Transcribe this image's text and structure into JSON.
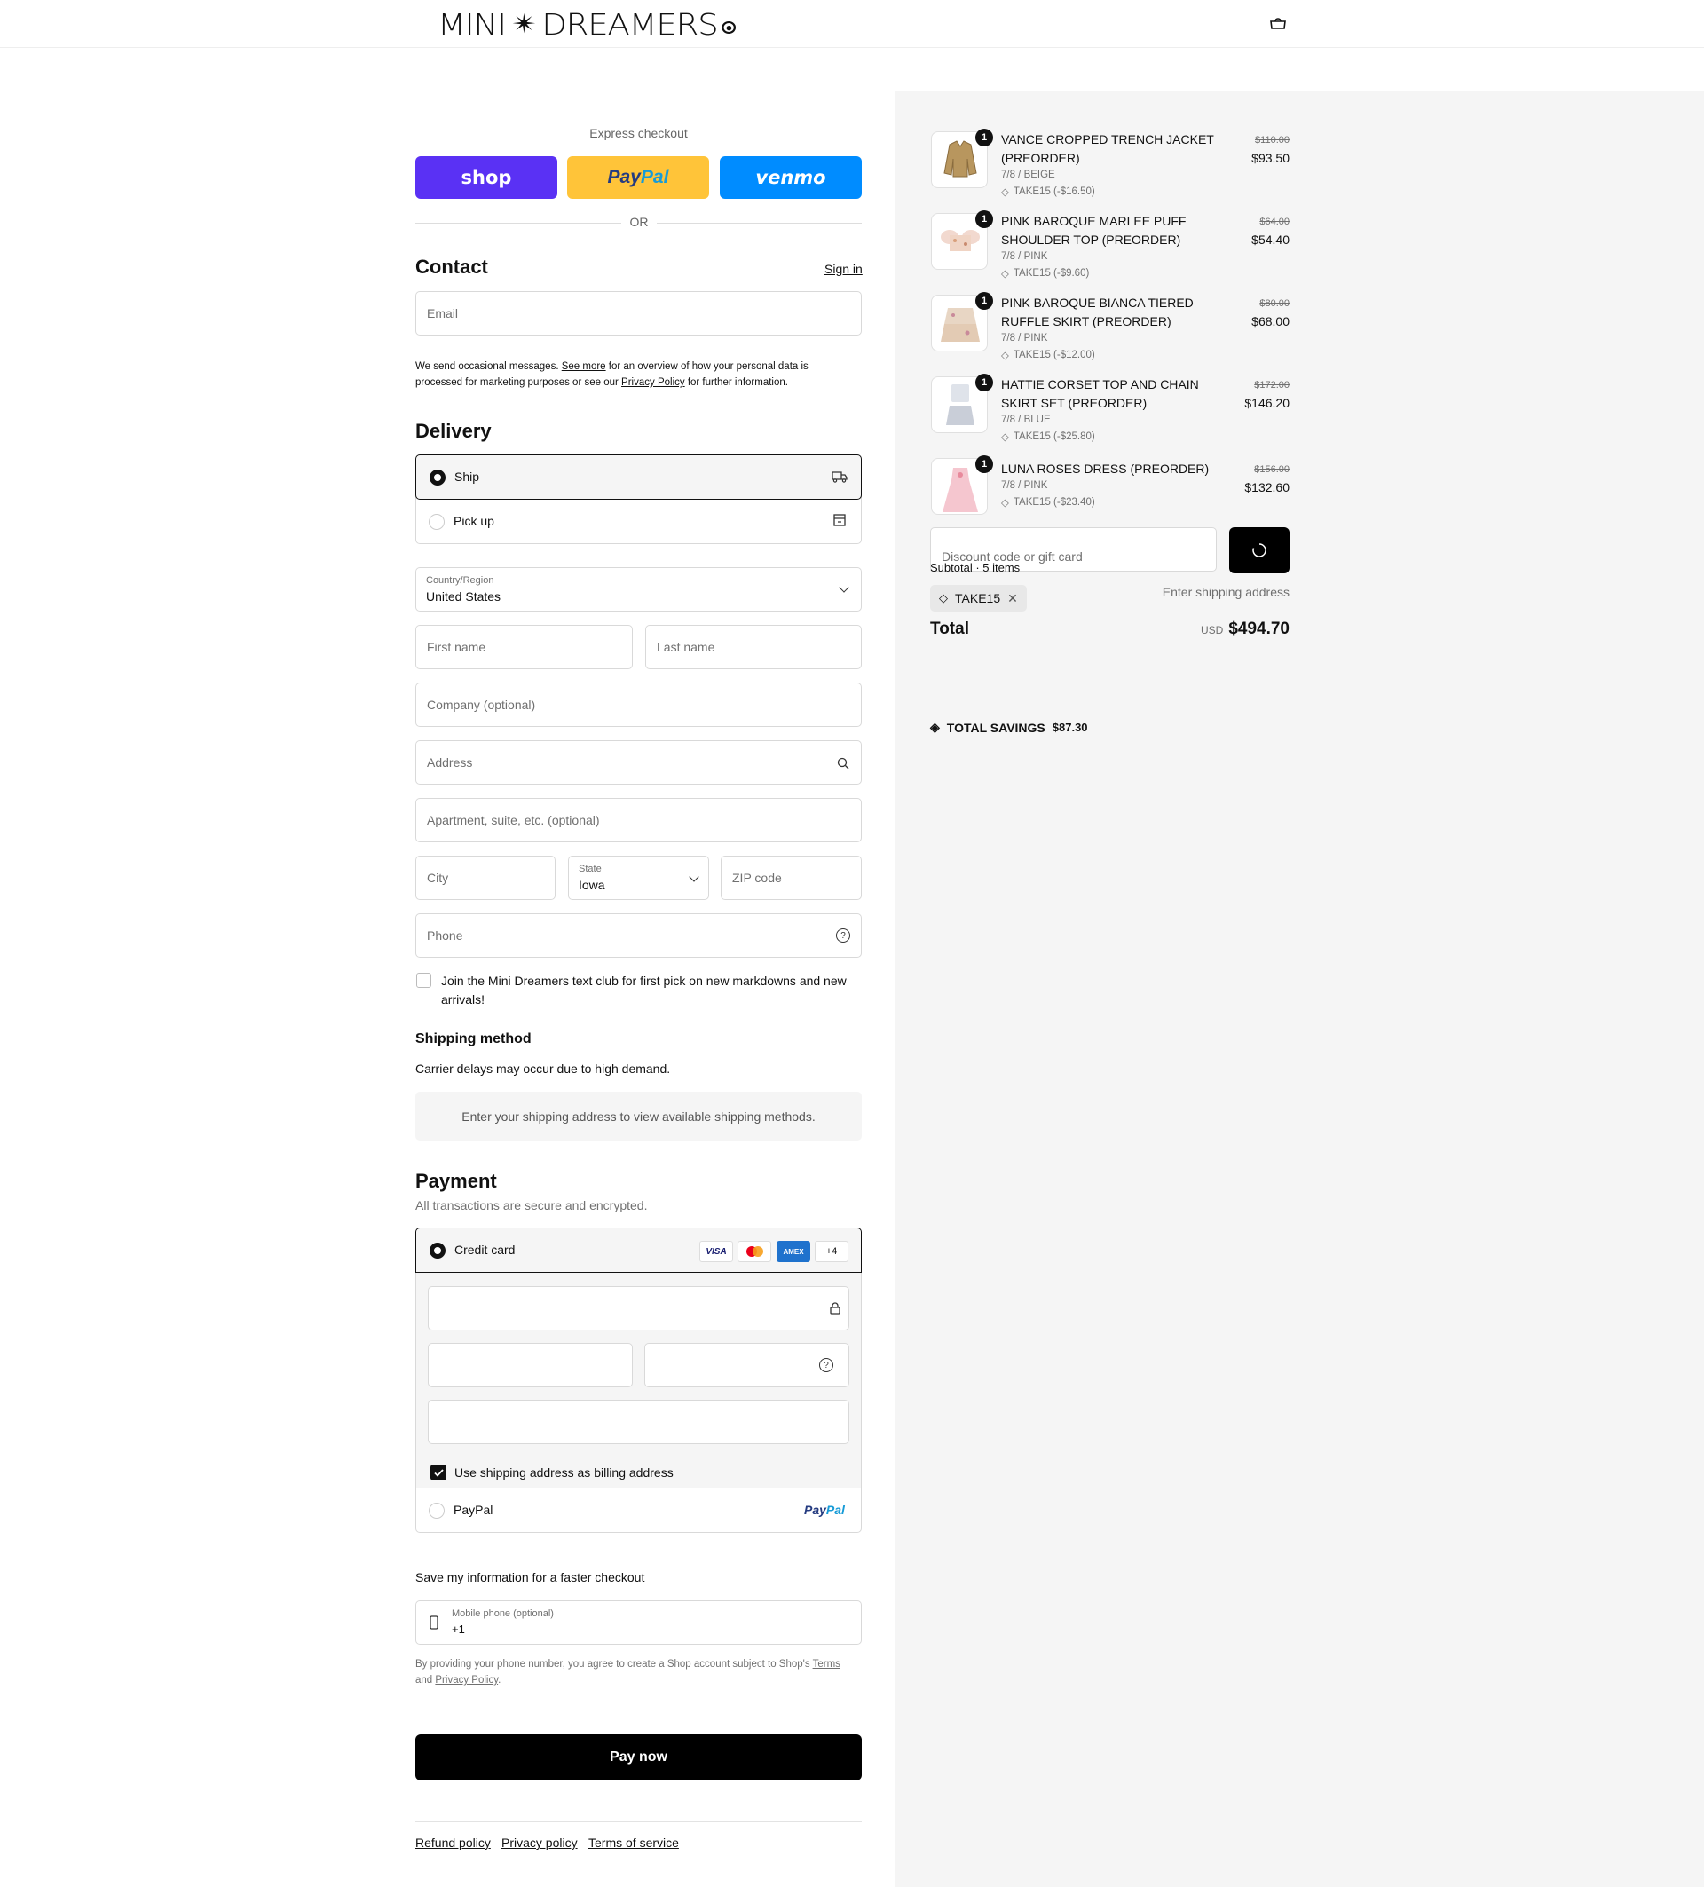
{
  "header": {
    "logo_text": "MINI",
    "logo_text2": "DREAMERS",
    "bag_icon": "bag-icon"
  },
  "express": {
    "label": "Express checkout",
    "shop": "shop",
    "paypal_1": "Pay",
    "paypal_2": "Pal",
    "venmo": "venmo",
    "or": "OR"
  },
  "contact": {
    "title": "Contact",
    "sign_in": "Sign in",
    "email_placeholder": "Email",
    "notice_1": "We send occasional messages. ",
    "notice_see_more": "See more",
    "notice_2": " for an overview of how your personal data is",
    "notice_3": "processed for marketing purposes or see our ",
    "notice_privacy": "Privacy Policy",
    "notice_4": " for further information."
  },
  "delivery": {
    "title": "Delivery",
    "ship": "Ship",
    "pickup": "Pick up",
    "country_label": "Country/Region",
    "country_value": "United States",
    "first_name": "First name",
    "last_name": "Last name",
    "company": "Company (optional)",
    "address": "Address",
    "apartment": "Apartment, suite, etc. (optional)",
    "city": "City",
    "state_label": "State",
    "state_value": "Iowa",
    "zip": "ZIP code",
    "phone": "Phone",
    "textclub_1": "Join the Mini Dreamers text club for first pick on new markdowns and new",
    "textclub_2": "arrivals!"
  },
  "shipping": {
    "title": "Shipping method",
    "note": "Carrier delays may occur due to high demand.",
    "placeholder": "Enter your shipping address to view available shipping methods."
  },
  "payment": {
    "title": "Payment",
    "subtitle": "All transactions are secure and encrypted.",
    "credit_card": "Credit card",
    "visa": "VISA",
    "amex": "AMEX",
    "more": "+4",
    "billing": "Use shipping address as billing address",
    "paypal": "PayPal",
    "paypal_logo_1": "Pay",
    "paypal_logo_2": "Pal"
  },
  "save": {
    "title": "Save my information for a faster checkout",
    "mobile_label": "Mobile phone (optional)",
    "mobile_value": "+1",
    "terms_1": "By providing your phone number, you agree to create a Shop account subject to Shop's ",
    "terms_link": "Terms",
    "terms_2": "and ",
    "privacy_link": "Privacy Policy",
    "terms_3": "."
  },
  "pay_now": "Pay now",
  "footer": {
    "refund": "Refund policy",
    "privacy": "Privacy policy",
    "terms": "Terms of service"
  },
  "cart": {
    "items": [
      {
        "qty": "1",
        "name": "VANCE CROPPED TRENCH JACKET (PREORDER)",
        "variant": "7/8 / BEIGE",
        "discount": "TAKE15 (-$16.50)",
        "old": "$110.00",
        "price": "$93.50"
      },
      {
        "qty": "1",
        "name": "PINK BAROQUE MARLEE PUFF SHOULDER TOP (PREORDER)",
        "variant": "7/8 / PINK",
        "discount": "TAKE15 (-$9.60)",
        "old": "$64.00",
        "price": "$54.40"
      },
      {
        "qty": "1",
        "name": "PINK BAROQUE BIANCA TIERED RUFFLE SKIRT (PREORDER)",
        "variant": "7/8 / PINK",
        "discount": "TAKE15 (-$12.00)",
        "old": "$80.00",
        "price": "$68.00"
      },
      {
        "qty": "1",
        "name": "HATTIE CORSET TOP AND CHAIN SKIRT SET (PREORDER)",
        "variant": "7/8 / BLUE",
        "discount": "TAKE15 (-$25.80)",
        "old": "$172.00",
        "price": "$146.20"
      },
      {
        "qty": "1",
        "name": "LUNA ROSES DRESS (PREORDER)",
        "variant": "7/8 / PINK",
        "discount": "TAKE15 (-$23.40)",
        "old": "$156.00",
        "price": "$132.60"
      }
    ],
    "discount_placeholder": "Discount code or gift card",
    "subtotal_label": "Subtotal · 5 items",
    "tag": "TAKE15",
    "shipping_value": "Enter shipping address",
    "total_label": "Total",
    "currency": "USD",
    "total": "$494.70",
    "savings_label": "TOTAL SAVINGS",
    "savings": "$87.30"
  }
}
